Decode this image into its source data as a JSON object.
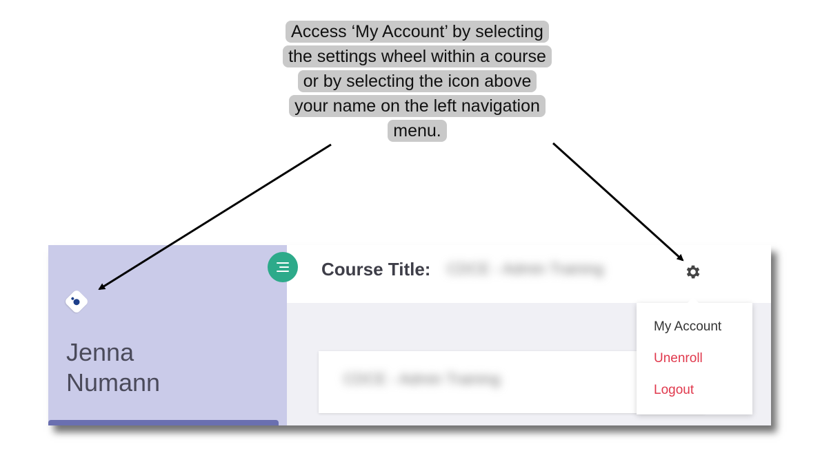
{
  "callout": {
    "lines": [
      "Access ‘My Account’ by selecting",
      "the settings wheel within a course",
      "or by selecting the icon above",
      "your name on the left navigation",
      "menu."
    ]
  },
  "sidebar": {
    "user_name_first": "Jenna",
    "user_name_last": "Numann",
    "avatar_icon": "avatar-dots-icon"
  },
  "header": {
    "menu_icon": "hamburger-menu-icon",
    "course_label": "Course Title:",
    "course_value": "CDCE - Admin Training",
    "settings_icon": "gear-icon"
  },
  "content": {
    "card_text": "CDCE - Admin Training"
  },
  "dropdown": {
    "items": [
      "My Account",
      "Unenroll",
      "Logout"
    ]
  },
  "colors": {
    "sidebar_bg": "#cacbe9",
    "menu_button": "#2daa8a",
    "danger": "#e0384c",
    "callout_bg": "#c9c9c9"
  }
}
